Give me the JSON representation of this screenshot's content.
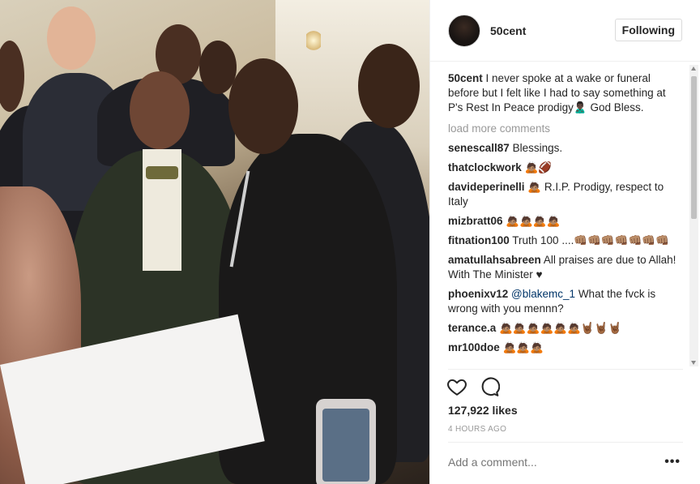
{
  "post": {
    "image_alt": ""
  },
  "header": {
    "username": "50cent",
    "follow_label": "Following"
  },
  "caption": {
    "user": "50cent",
    "text": "I never spoke at a wake or funeral before but I felt like I had to say something at P's Rest In Peace prodigy🙎🏿‍♂️ God Bless."
  },
  "load_more_label": "load more comments",
  "comments": [
    {
      "user": "senescall87",
      "text": "Blessings."
    },
    {
      "user": "thatclockwork",
      "text": "🙇🏽🏈"
    },
    {
      "user": "davideperinelli",
      "text": "🙇🏽 R.I.P. Prodigy, respect to Italy"
    },
    {
      "user": "mizbratt06",
      "text": "🙇🏽🙇🏽🙇🏽🙇🏽"
    },
    {
      "user": "fitnation100",
      "text": "Truth 100 ....👊🏽👊🏽👊🏽👊🏽👊🏽👊🏽👊🏽"
    },
    {
      "user": "amatullahsabreen",
      "text": "All praises are due to Allah! With The Minister ♥"
    },
    {
      "user": "phoenixv12",
      "mention": "@blakemc_1",
      "text": "What the fvck is wrong with you mennn?"
    },
    {
      "user": "terance.a",
      "text": "🙇🏽🙇🏽🙇🏽🙇🏽🙇🏽🙇🏽🤘🏾🤘🏾🤘🏾"
    },
    {
      "user": "mr100doe",
      "text": "🙇🏽🙇🏽🙇🏽"
    }
  ],
  "icons": {
    "like": "heart-outline-icon",
    "comment": "speech-bubble-icon",
    "more": "ellipsis-icon"
  },
  "likes_label": "127,922 likes",
  "timestamp": "4 HOURS AGO",
  "add_comment_placeholder": "Add a comment...",
  "more_label": "•••",
  "colors": {
    "text": "#262626",
    "muted": "#999999",
    "border": "#dbdbdb",
    "link": "#003569"
  }
}
